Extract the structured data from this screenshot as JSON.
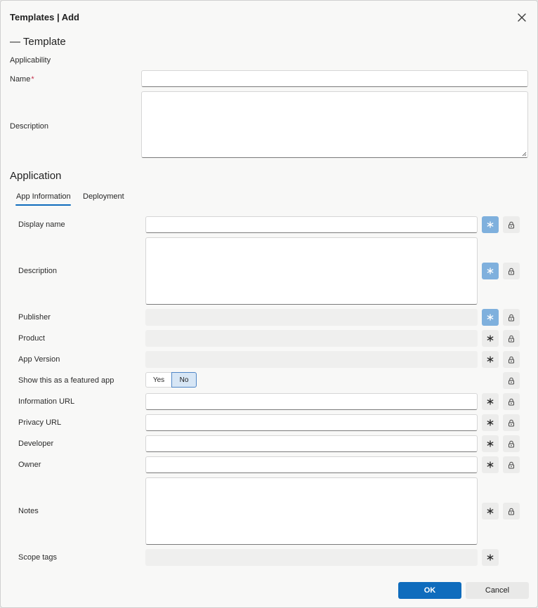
{
  "dialog": {
    "title": "Templates | Add"
  },
  "template": {
    "heading": "— Template",
    "applicability_label": "Applicability",
    "name_label": "Name",
    "name_required_marker": "*",
    "name_value": "",
    "description_label": "Description",
    "description_value": ""
  },
  "application": {
    "heading": "Application",
    "tabs": [
      {
        "label": "App Information",
        "selected": true
      },
      {
        "label": "Deployment",
        "selected": false
      }
    ],
    "fields": {
      "display_name": {
        "label": "Display name",
        "value": ""
      },
      "description": {
        "label": "Description",
        "value": ""
      },
      "publisher": {
        "label": "Publisher",
        "value": ""
      },
      "product": {
        "label": "Product",
        "value": ""
      },
      "app_version": {
        "label": "App Version",
        "value": ""
      },
      "featured": {
        "label": "Show this as a featured app",
        "yes_label": "Yes",
        "no_label": "No",
        "selected": "No"
      },
      "information_url": {
        "label": "Information URL",
        "value": ""
      },
      "privacy_url": {
        "label": "Privacy URL",
        "value": ""
      },
      "developer": {
        "label": "Developer",
        "value": ""
      },
      "owner": {
        "label": "Owner",
        "value": ""
      },
      "notes": {
        "label": "Notes",
        "value": ""
      },
      "scope_tags": {
        "label": "Scope tags",
        "value": ""
      }
    }
  },
  "footer": {
    "ok_label": "OK",
    "cancel_label": "Cancel"
  },
  "icons": {
    "close": "close-icon",
    "asterisk": "asterisk-icon",
    "lock": "lock-icon"
  },
  "colors": {
    "accent": "#0f6cbd",
    "active_icon_bg": "#7fb0dd",
    "required": "#c4314b"
  }
}
